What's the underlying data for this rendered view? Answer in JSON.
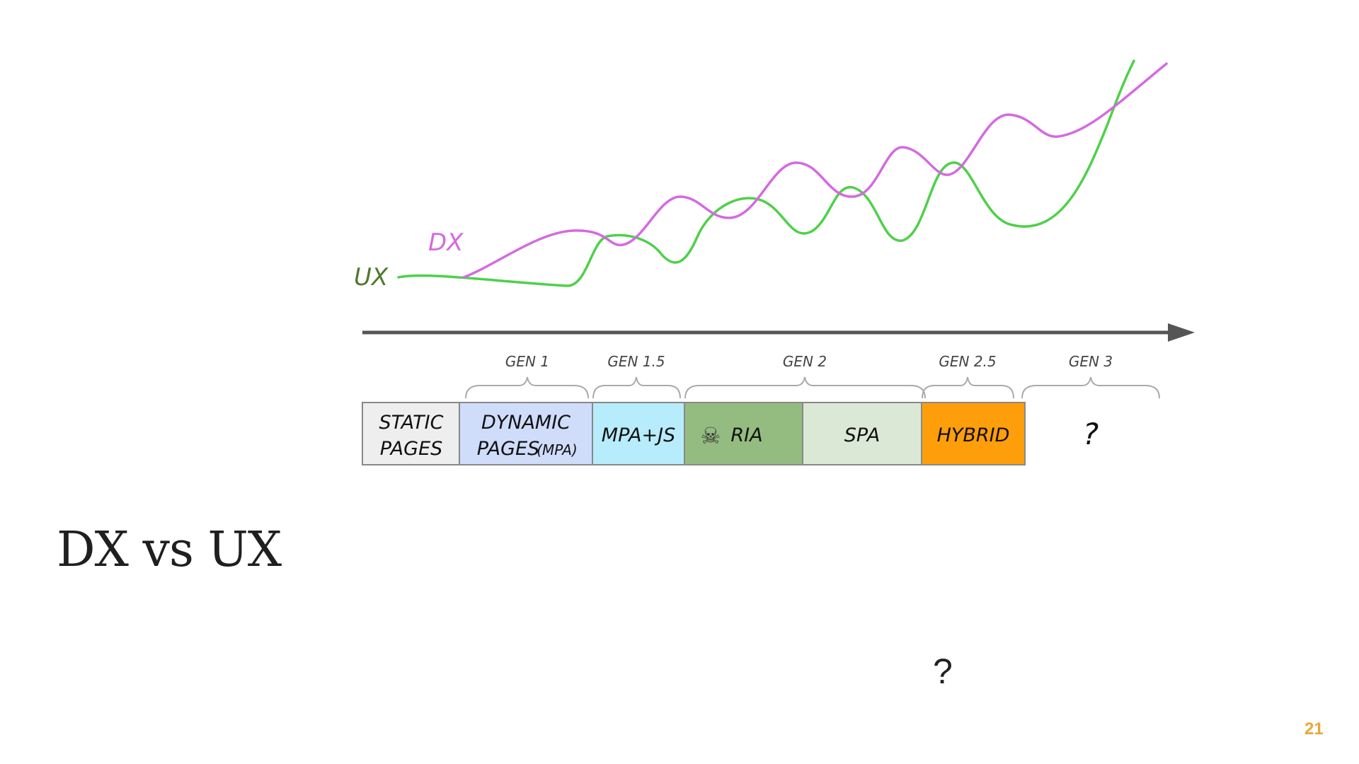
{
  "slide": {
    "title": "DX vs UX",
    "question": "?",
    "page_number": "21"
  },
  "curves": {
    "dx_label": "DX",
    "ux_label": "UX",
    "dx_color": "#d46ae0",
    "ux_color": "#4fd04a"
  },
  "generations": [
    {
      "label": "GEN 1"
    },
    {
      "label": "GEN 1.5"
    },
    {
      "label": "GEN 2"
    },
    {
      "label": "GEN 2.5"
    },
    {
      "label": "GEN 3"
    }
  ],
  "stages": [
    {
      "line1": "STATIC",
      "line2": "PAGES",
      "color": "#eeeeee"
    },
    {
      "line1": "DYNAMIC",
      "line2": "PAGES",
      "line2_small": "(MPA)",
      "color": "#cfdcfa"
    },
    {
      "line1": "MPA+JS",
      "color": "#b6ecfb"
    },
    {
      "line1": "RIA",
      "icon": "skull-crossbones-icon",
      "icon_glyph": "☠",
      "color": "#94bc80"
    },
    {
      "line1": "SPA",
      "color": "#dbe8d6"
    },
    {
      "line1": "HYBRID",
      "color": "#ff9e0b"
    },
    {
      "line1": "?"
    }
  ],
  "timeline": {
    "arrow_color": "#555555"
  }
}
